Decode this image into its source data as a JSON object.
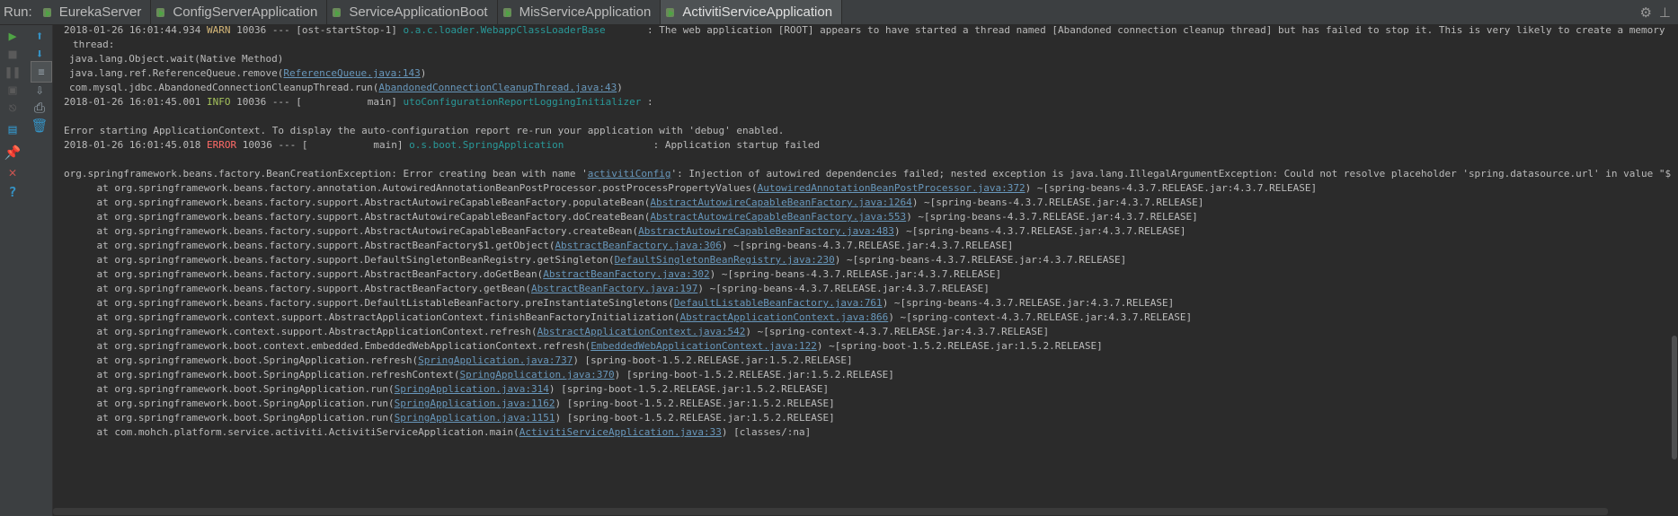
{
  "run_label": "Run:",
  "tabs": [
    {
      "label": "EurekaServer",
      "active": false
    },
    {
      "label": "ConfigServerApplication",
      "active": false
    },
    {
      "label": "ServiceApplicationBoot",
      "active": false
    },
    {
      "label": "MisServiceApplication",
      "active": false
    },
    {
      "label": "ActivitiServiceApplication",
      "active": true
    }
  ],
  "toolbar_icons": [
    "gear-icon",
    "minimize-icon"
  ],
  "sidebar_icons": [
    "rerun-icon",
    "stop-icon",
    "pause-icon",
    "dump-threads-icon",
    "exit-icon",
    "scroll-up-icon",
    "scroll-down-icon",
    "soft-wrap-icon",
    "scroll-to-end-icon",
    "print-icon",
    "clear-icon",
    "pin-icon",
    "close-icon",
    "help-icon"
  ],
  "log": {
    "l1_ts": "2018-01-26 16:01:44.934",
    "l1_level": "WARN",
    "l1_pid": "10036 --- [ost-startStop-1]",
    "l1_logger": "o.a.c.loader.WebappClassLoaderBase",
    "l1_msg": ": The web application [ROOT] appears to have started a thread named [Abandoned connection cleanup thread] but has failed to stop it. This is very likely to create a memory leak. Stack trace of",
    "l2": "thread:",
    "l3": "java.lang.Object.wait(Native Method)",
    "l4_pre": "java.lang.ref.ReferenceQueue.remove(",
    "l4_link": "ReferenceQueue.java:143",
    "l4_post": ")",
    "l5_pre": "com.mysql.jdbc.AbandonedConnectionCleanupThread.run(",
    "l5_link": "AbandonedConnectionCleanupThread.java:43",
    "l5_post": ")",
    "l6_ts": "2018-01-26 16:01:45.001",
    "l6_level": "INFO",
    "l6_pid": "10036 --- [           main]",
    "l6_logger": "utoConfigurationReportLoggingInitializer",
    "l6_msg": ":",
    "l7": "Error starting ApplicationContext. To display the auto-configuration report re-run your application with 'debug' enabled.",
    "l8_ts": "2018-01-26 16:01:45.018",
    "l8_level": "ERROR",
    "l8_pid": "10036 --- [           main]",
    "l8_logger": "o.s.boot.SpringApplication",
    "l8_msg": ": Application startup failed",
    "l9_pre": "org.springframework.beans.factory.BeanCreationException: Error creating bean with name '",
    "l9_link": "activitiConfig",
    "l9_post": "': Injection of autowired dependencies failed; nested exception is java.lang.IllegalArgumentException: Could not resolve placeholder 'spring.datasource.url' in value \"${spring.datasource.url}\"",
    "stack": [
      {
        "pre": "at org.springframework.beans.factory.annotation.AutowiredAnnotationBeanPostProcessor.postProcessPropertyValues(",
        "link": "AutowiredAnnotationBeanPostProcessor.java:372",
        "post": ") ~[spring-beans-4.3.7.RELEASE.jar:4.3.7.RELEASE]"
      },
      {
        "pre": "at org.springframework.beans.factory.support.AbstractAutowireCapableBeanFactory.populateBean(",
        "link": "AbstractAutowireCapableBeanFactory.java:1264",
        "post": ") ~[spring-beans-4.3.7.RELEASE.jar:4.3.7.RELEASE]"
      },
      {
        "pre": "at org.springframework.beans.factory.support.AbstractAutowireCapableBeanFactory.doCreateBean(",
        "link": "AbstractAutowireCapableBeanFactory.java:553",
        "post": ") ~[spring-beans-4.3.7.RELEASE.jar:4.3.7.RELEASE]"
      },
      {
        "pre": "at org.springframework.beans.factory.support.AbstractAutowireCapableBeanFactory.createBean(",
        "link": "AbstractAutowireCapableBeanFactory.java:483",
        "post": ") ~[spring-beans-4.3.7.RELEASE.jar:4.3.7.RELEASE]"
      },
      {
        "pre": "at org.springframework.beans.factory.support.AbstractBeanFactory$1.getObject(",
        "link": "AbstractBeanFactory.java:306",
        "post": ") ~[spring-beans-4.3.7.RELEASE.jar:4.3.7.RELEASE]"
      },
      {
        "pre": "at org.springframework.beans.factory.support.DefaultSingletonBeanRegistry.getSingleton(",
        "link": "DefaultSingletonBeanRegistry.java:230",
        "post": ") ~[spring-beans-4.3.7.RELEASE.jar:4.3.7.RELEASE]"
      },
      {
        "pre": "at org.springframework.beans.factory.support.AbstractBeanFactory.doGetBean(",
        "link": "AbstractBeanFactory.java:302",
        "post": ") ~[spring-beans-4.3.7.RELEASE.jar:4.3.7.RELEASE]"
      },
      {
        "pre": "at org.springframework.beans.factory.support.AbstractBeanFactory.getBean(",
        "link": "AbstractBeanFactory.java:197",
        "post": ") ~[spring-beans-4.3.7.RELEASE.jar:4.3.7.RELEASE]"
      },
      {
        "pre": "at org.springframework.beans.factory.support.DefaultListableBeanFactory.preInstantiateSingletons(",
        "link": "DefaultListableBeanFactory.java:761",
        "post": ") ~[spring-beans-4.3.7.RELEASE.jar:4.3.7.RELEASE]"
      },
      {
        "pre": "at org.springframework.context.support.AbstractApplicationContext.finishBeanFactoryInitialization(",
        "link": "AbstractApplicationContext.java:866",
        "post": ") ~[spring-context-4.3.7.RELEASE.jar:4.3.7.RELEASE]"
      },
      {
        "pre": "at org.springframework.context.support.AbstractApplicationContext.refresh(",
        "link": "AbstractApplicationContext.java:542",
        "post": ") ~[spring-context-4.3.7.RELEASE.jar:4.3.7.RELEASE]"
      },
      {
        "pre": "at org.springframework.boot.context.embedded.EmbeddedWebApplicationContext.refresh(",
        "link": "EmbeddedWebApplicationContext.java:122",
        "post": ") ~[spring-boot-1.5.2.RELEASE.jar:1.5.2.RELEASE]"
      },
      {
        "pre": "at org.springframework.boot.SpringApplication.refresh(",
        "link": "SpringApplication.java:737",
        "post": ") [spring-boot-1.5.2.RELEASE.jar:1.5.2.RELEASE]"
      },
      {
        "pre": "at org.springframework.boot.SpringApplication.refreshContext(",
        "link": "SpringApplication.java:370",
        "post": ") [spring-boot-1.5.2.RELEASE.jar:1.5.2.RELEASE]"
      },
      {
        "pre": "at org.springframework.boot.SpringApplication.run(",
        "link": "SpringApplication.java:314",
        "post": ") [spring-boot-1.5.2.RELEASE.jar:1.5.2.RELEASE]"
      },
      {
        "pre": "at org.springframework.boot.SpringApplication.run(",
        "link": "SpringApplication.java:1162",
        "post": ") [spring-boot-1.5.2.RELEASE.jar:1.5.2.RELEASE]"
      },
      {
        "pre": "at org.springframework.boot.SpringApplication.run(",
        "link": "SpringApplication.java:1151",
        "post": ") [spring-boot-1.5.2.RELEASE.jar:1.5.2.RELEASE]"
      },
      {
        "pre": "at com.mohch.platform.service.activiti.ActivitiServiceApplication.main(",
        "link": "ActivitiServiceApplication.java:33",
        "post": ") [classes/:na]"
      }
    ]
  }
}
